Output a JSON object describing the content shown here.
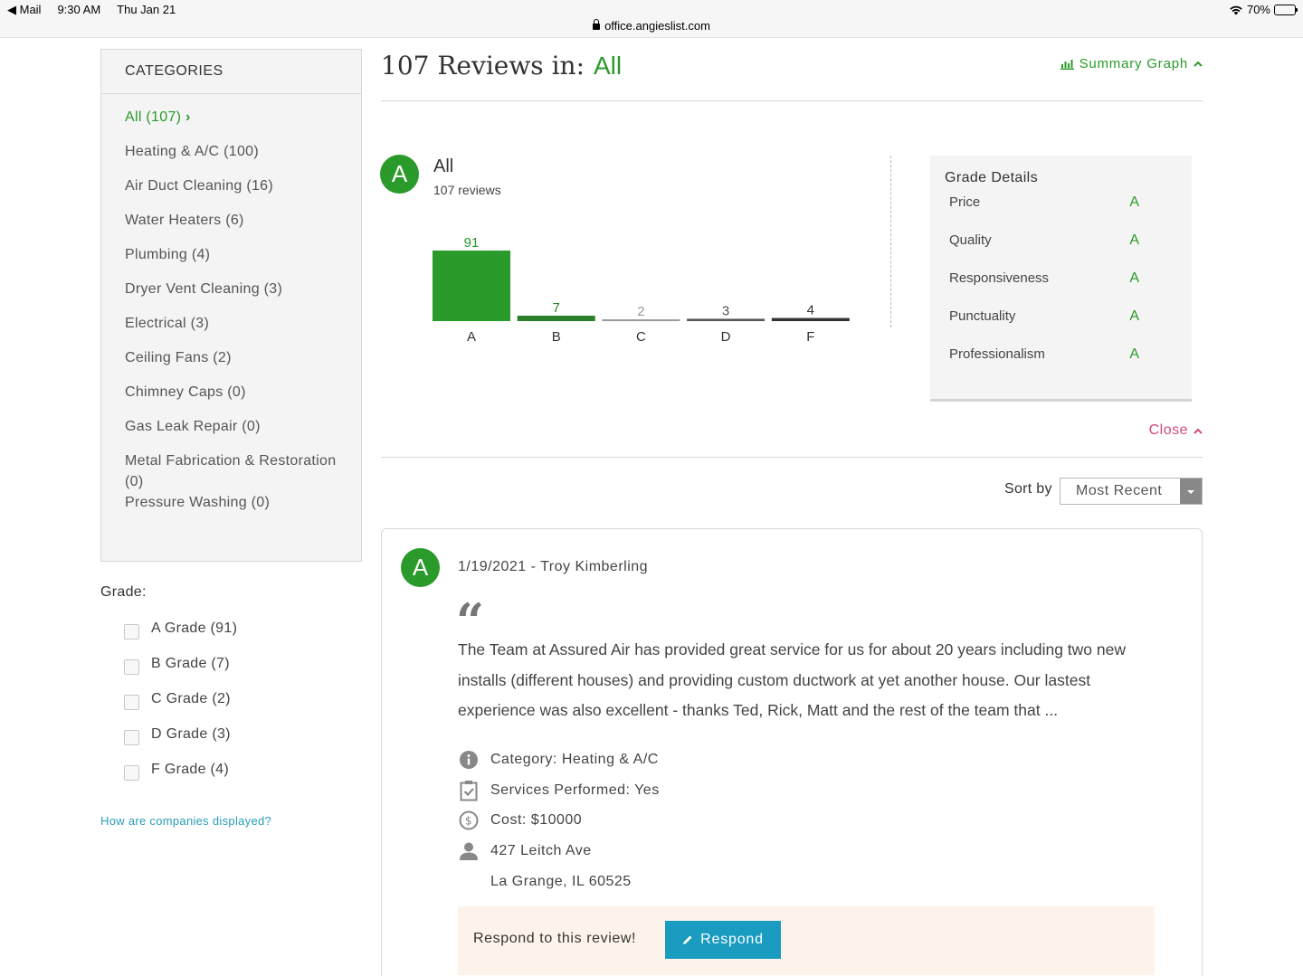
{
  "status_bar": {
    "back_app": "Mail",
    "time": "9:30 AM",
    "date": "Thu Jan 21",
    "url": "office.angieslist.com",
    "battery": "70%",
    "battery_level": 0.7
  },
  "sidebar": {
    "categories_title": "CATEGORIES",
    "categories": [
      {
        "label": "All (107)",
        "active": true
      },
      {
        "label": "Heating & A/C (100)"
      },
      {
        "label": "Air Duct Cleaning (16)"
      },
      {
        "label": "Water Heaters (6)"
      },
      {
        "label": "Plumbing (4)"
      },
      {
        "label": "Dryer Vent Cleaning (3)"
      },
      {
        "label": "Electrical (3)"
      },
      {
        "label": "Ceiling Fans (2)"
      },
      {
        "label": "Chimney Caps (0)"
      },
      {
        "label": "Gas Leak Repair (0)"
      },
      {
        "label": "Metal Fabrication & Restoration (0)"
      },
      {
        "label": "Pressure Washing (0)"
      }
    ],
    "grade_title": "Grade:",
    "grades": [
      {
        "label": "A Grade (91)"
      },
      {
        "label": "B Grade (7)"
      },
      {
        "label": "C Grade (2)"
      },
      {
        "label": "D Grade (3)"
      },
      {
        "label": "F Grade (4)"
      }
    ],
    "how_link": "How are companies displayed?"
  },
  "header": {
    "title_prefix": "107 Reviews in:",
    "title_highlight": "All",
    "summary_link": "Summary Graph"
  },
  "summary": {
    "grade": "A",
    "name": "All",
    "count": "107 reviews"
  },
  "chart_data": {
    "type": "bar",
    "categories": [
      "A",
      "B",
      "C",
      "D",
      "F"
    ],
    "values": [
      91,
      7,
      2,
      3,
      4
    ],
    "colors": [
      "#2a9a2a",
      "#2a7f2a",
      "#9a9a9a",
      "#555555",
      "#333333"
    ]
  },
  "grade_details": {
    "title": "Grade Details",
    "rows": [
      {
        "label": "Price",
        "grade": "A"
      },
      {
        "label": "Quality",
        "grade": "A"
      },
      {
        "label": "Responsiveness",
        "grade": "A"
      },
      {
        "label": "Punctuality",
        "grade": "A"
      },
      {
        "label": "Professionalism",
        "grade": "A"
      }
    ]
  },
  "close_link": "Close",
  "sort": {
    "label": "Sort by",
    "selected": "Most Recent"
  },
  "review": {
    "grade": "A",
    "meta": "1/19/2021 - Troy Kimberling",
    "quote_mark": "“",
    "text": "The Team at Assured Air has provided great service for us for about 20 years including two new installs (different houses) and providing custom ductwork at yet another house. Our lastest experience was also excellent - thanks Ted, Rick, Matt and the rest of the team that ...",
    "category": "Category: Heating & A/C",
    "services": "Services Performed: Yes",
    "cost": "Cost: $10000",
    "address1": "427 Leitch Ave",
    "address2": "La Grange, IL 60525",
    "respond_prompt": "Respond to this review!",
    "respond_button": "Respond"
  },
  "colors": {
    "accent_green": "#2a9a2a",
    "close_pink": "#d04880",
    "respond_blue": "#1a9bc0",
    "link_teal": "#2a9bb8"
  }
}
